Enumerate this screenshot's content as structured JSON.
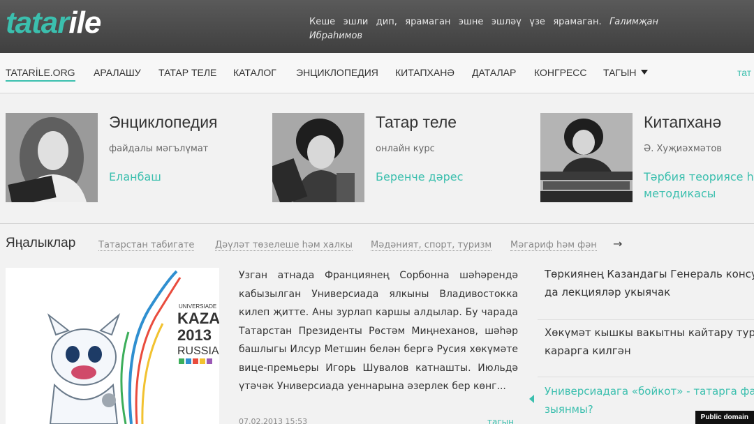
{
  "header": {
    "logo_part1": "tatar",
    "logo_part2": "ile",
    "quote": "Кеше эшли дип, ярамаган эшне эшләү үзе ярамаган.",
    "quote_author": "Галимҗан Ибраһимов"
  },
  "nav": {
    "items": [
      "TATARİLE.ORG",
      "АРАЛАШУ",
      "ТАТАР ТЕЛЕ",
      "КАТАЛОГ",
      "ЭНЦИКЛОПЕДИЯ",
      "КИТАПХАНӘ",
      "ДАТАЛАР",
      "КОНГРЕСС",
      "ТАГЫН"
    ],
    "right_item": "тат"
  },
  "cards": [
    {
      "title": "Энциклопедия",
      "subtitle": "файдалы мәгълүмат",
      "link": "Еланбаш"
    },
    {
      "title": "Татар теле",
      "subtitle": "онлайн курс",
      "link": "Беренче дәрес"
    },
    {
      "title": "Китапханә",
      "subtitle": "Ә. Хуҗиәхмәтов",
      "link": "Тәрбия теориясе һ методикасы"
    }
  ],
  "news": {
    "title": "Яңалыклар",
    "tabs": [
      "Татарстан табигате",
      "Дәүләт төзелеше һәм халкы",
      "Мәдәният, спорт, туризм",
      "Мәгариф һәм фән"
    ],
    "arrow": "→",
    "image_text": {
      "line1": "UNIVERSIADE",
      "line2": "KAZAN",
      "line3": "2013",
      "line4": "RUSSIA"
    },
    "body": "Узган атнада Франциянең Сорбонна шәһәрендә кабызылган Универсиада ялкыны Владивостокка килеп җитте. Аны зурлап каршы алдылар. Бу чарада Татарстан Президенты Рөстәм Миңнеханов, шәһәр башлыгы Илсур Метшин белән бергә Русия хөкүмәте вице-премьеры Игорь Шувалов катнашты. Июльдә үтәчәк Универсиада уеннарына әзерлек бер көнг...",
    "date": "07.02.2013 15:53",
    "more": "тагын"
  },
  "side": [
    {
      "line1": "Төркиянең Казандагы Генераль консу",
      "line2": "да лекцияләр укыячак"
    },
    {
      "line1": "Хөкүмәт кышкы вакытны кайтару туры",
      "line2": "карарга килгән"
    },
    {
      "line1": "Универсиадага «бойкот» - татарга фа",
      "line2": "зыянмы?"
    }
  ],
  "credit": "Public domain",
  "colors": {
    "accent": "#3bbfae",
    "header_bg": "#4a4a4a"
  }
}
